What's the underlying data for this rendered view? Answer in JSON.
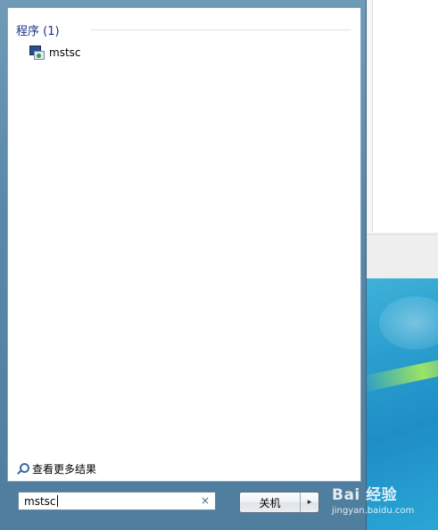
{
  "results": {
    "group_heading": "程序 (1)",
    "items": [
      {
        "label": "mstsc",
        "icon": "remote-desktop-icon"
      }
    ],
    "more_results": "查看更多结果"
  },
  "search": {
    "value": "mstsc",
    "clear_glyph": "×"
  },
  "shutdown": {
    "label": "关机",
    "arrow_glyph": "▸"
  },
  "watermark": {
    "logo": "Bai 经验",
    "url": "jingyan.baidu.com"
  }
}
